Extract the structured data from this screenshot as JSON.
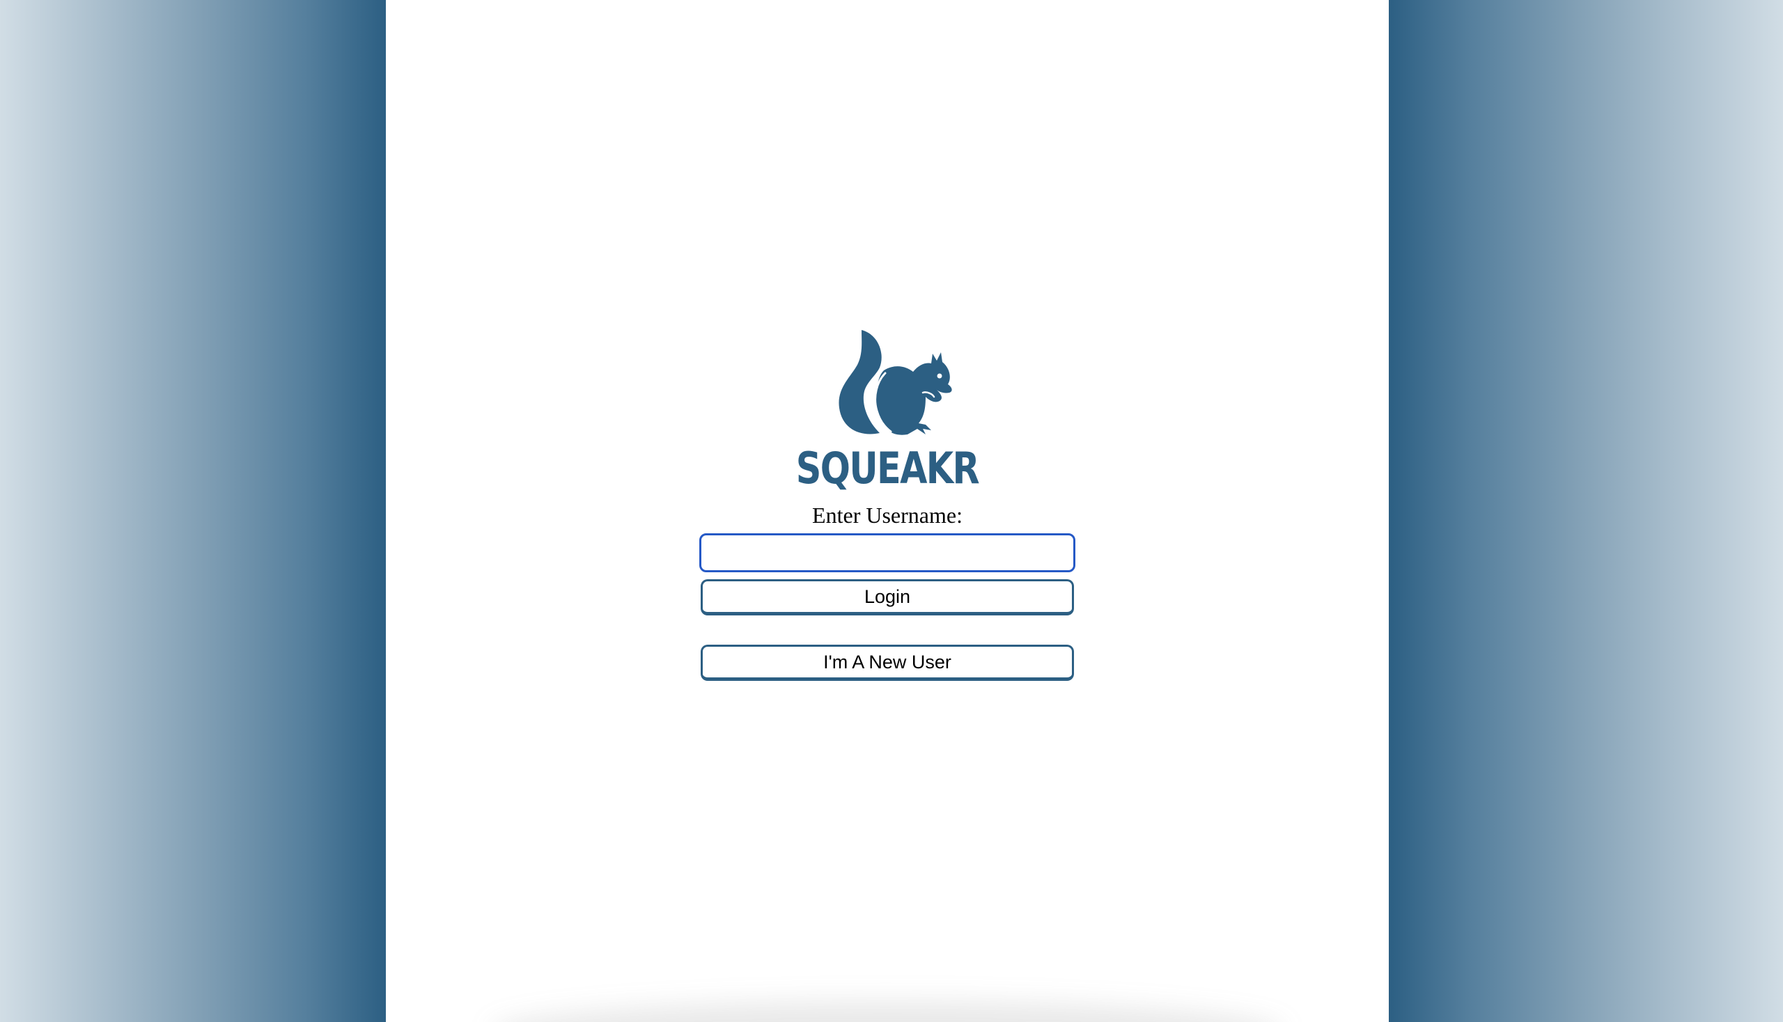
{
  "brand": {
    "name": "SQUEAKR",
    "logo_icon": "squirrel-icon",
    "color": "#2c5f83"
  },
  "login_form": {
    "username_label": "Enter Username:",
    "username_value": "",
    "username_placeholder": "",
    "login_button_label": "Login",
    "new_user_button_label": "I'm A New User"
  },
  "colors": {
    "accent": "#2c5f83",
    "input_focus_border": "#2559c6",
    "panel_background": "#ffffff"
  }
}
